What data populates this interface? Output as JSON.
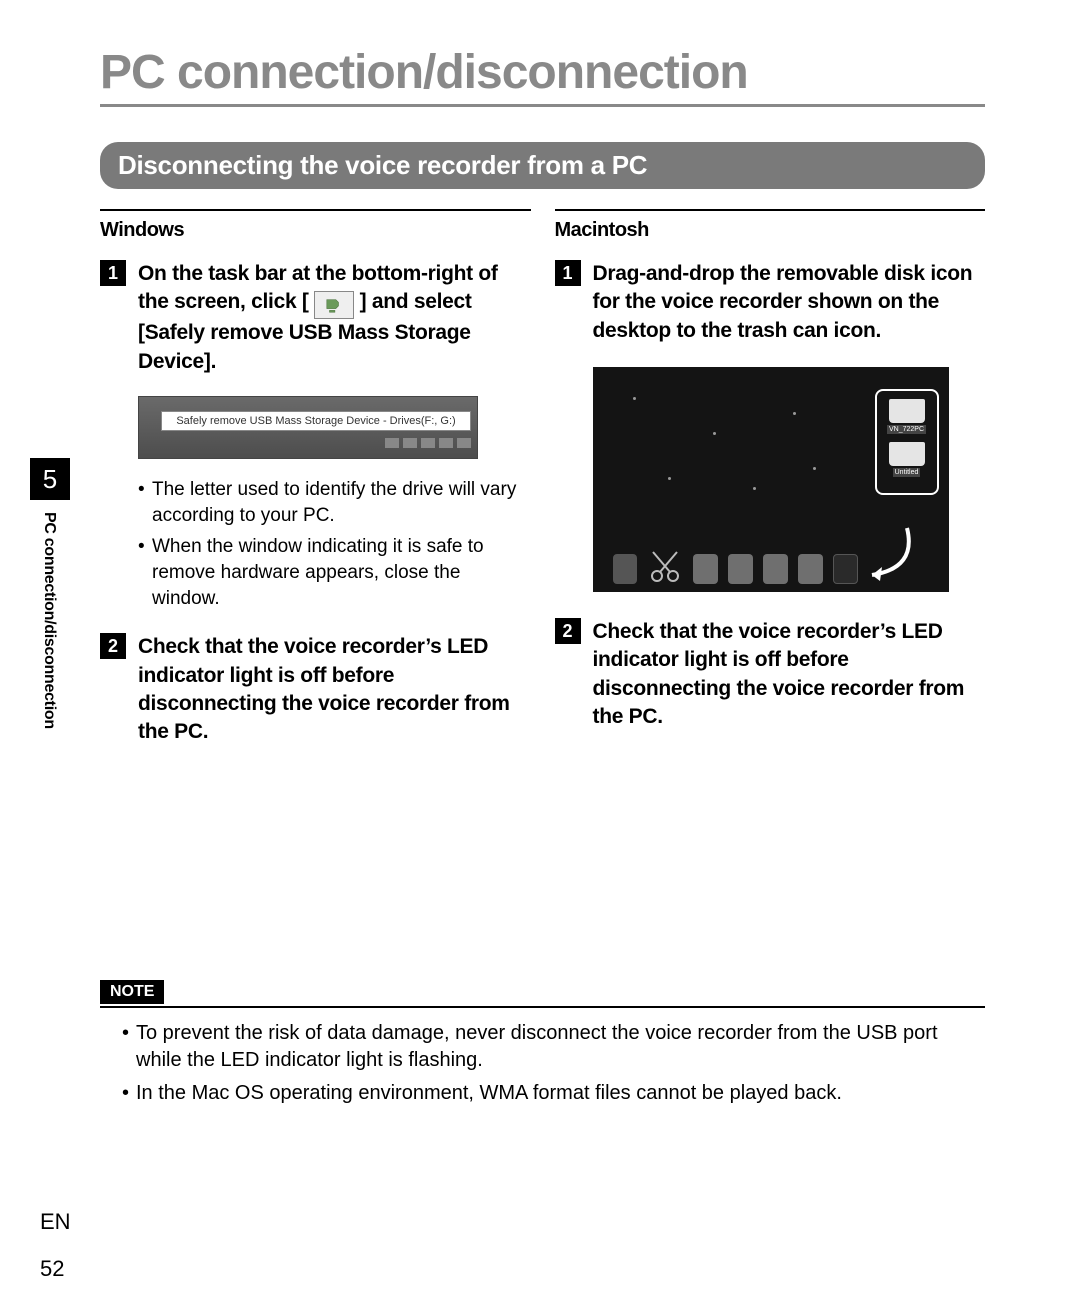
{
  "page_title": "PC connection/disconnection",
  "section_title": "Disconnecting the voice recorder from a PC",
  "chapter_number": "5",
  "side_tab_text": "PC connection/disconnection",
  "footer_lang": "EN",
  "footer_page": "52",
  "windows": {
    "label": "Windows",
    "step1_a": "On the task bar at the bottom-right of the screen, click [",
    "step1_b": "] and select [",
    "step1_c": "Safely remove USB Mass Storage Device",
    "step1_d": "].",
    "balloon_text": "Safely remove USB Mass Storage Device - Drives(F:, G:)",
    "bullet1": "The letter used to identify the drive will vary according to your PC.",
    "bullet2": "When the window indicating it is safe to remove hardware appears, close the window.",
    "step2": "Check that the voice recorder’s LED indicator light is off before disconnecting the voice recorder from the PC."
  },
  "mac": {
    "label": "Macintosh",
    "step1": "Drag-and-drop the removable disk icon for the voice recorder shown on the desktop to the trash can icon.",
    "drive1_label": "VN_722PC",
    "drive2_label": "Untitled",
    "step2": "Check that the voice recorder’s LED indicator light is off before disconnecting the voice recorder from the PC."
  },
  "note": {
    "label": "NOTE",
    "bullet1": "To prevent the risk of data damage, never disconnect the voice recorder from the USB port while the LED indicator light is flashing.",
    "bullet2": "In the Mac OS operating environment, WMA format files cannot be played back."
  }
}
